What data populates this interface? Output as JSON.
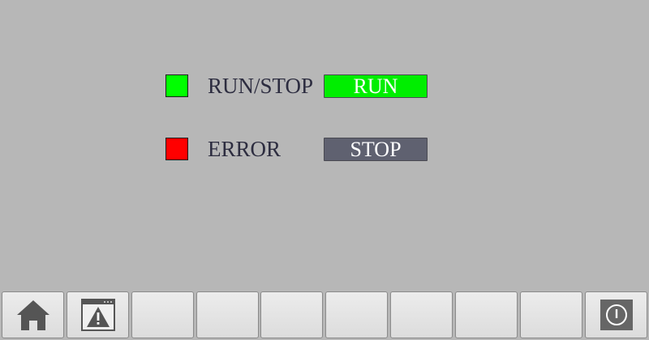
{
  "rows": [
    {
      "label": "RUN/STOP",
      "indicator_color": "#00ff00",
      "state_text": "RUN",
      "state_color": "#00ee00"
    },
    {
      "label": "ERROR",
      "indicator_color": "#ff0000",
      "state_text": "STOP",
      "state_color": "#5f6170"
    }
  ],
  "footer": {
    "keys": [
      {
        "icon": "home-icon"
      },
      {
        "icon": "alarm-window-icon"
      },
      {
        "icon": ""
      },
      {
        "icon": ""
      },
      {
        "icon": ""
      },
      {
        "icon": ""
      },
      {
        "icon": ""
      },
      {
        "icon": ""
      },
      {
        "icon": ""
      },
      {
        "icon": "power-icon"
      }
    ]
  }
}
